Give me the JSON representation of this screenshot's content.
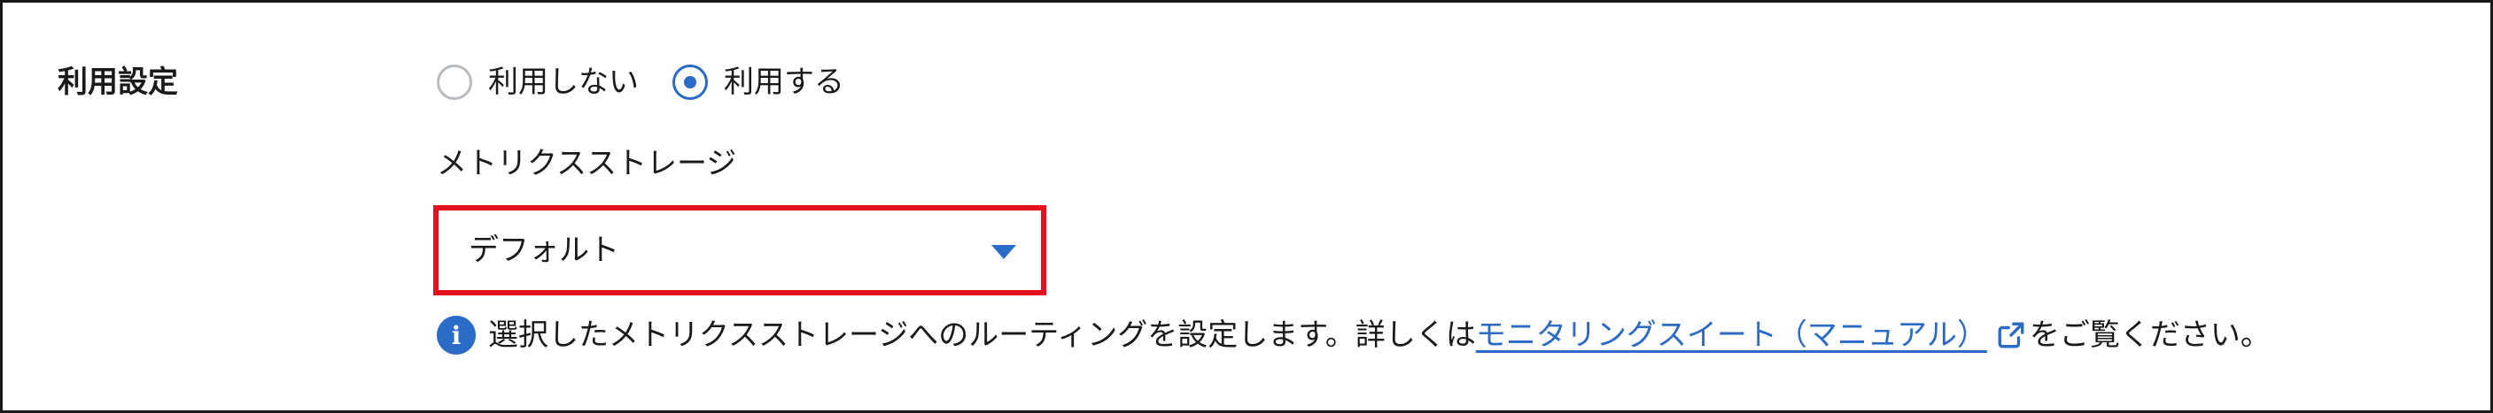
{
  "setting": {
    "label": "利用設定",
    "options": [
      {
        "label": "利用しない",
        "selected": false
      },
      {
        "label": "利用する",
        "selected": true
      }
    ]
  },
  "metrics_storage": {
    "label": "メトリクスストレージ",
    "selected_value": "デフォルト"
  },
  "help": {
    "text": "選択したメトリクスストレージへのルーティングを設定します。詳しくは",
    "link_text": "モニタリングスイート（マニュアル）",
    "tail": "をご覧ください。"
  },
  "colors": {
    "accent": "#2b6bc8",
    "highlight_border": "#e4101f",
    "radio_unchecked_border": "#b8bcc2"
  },
  "icons": {
    "info": "info-icon",
    "external_link": "external-link-icon",
    "dropdown": "caret-down-icon"
  }
}
